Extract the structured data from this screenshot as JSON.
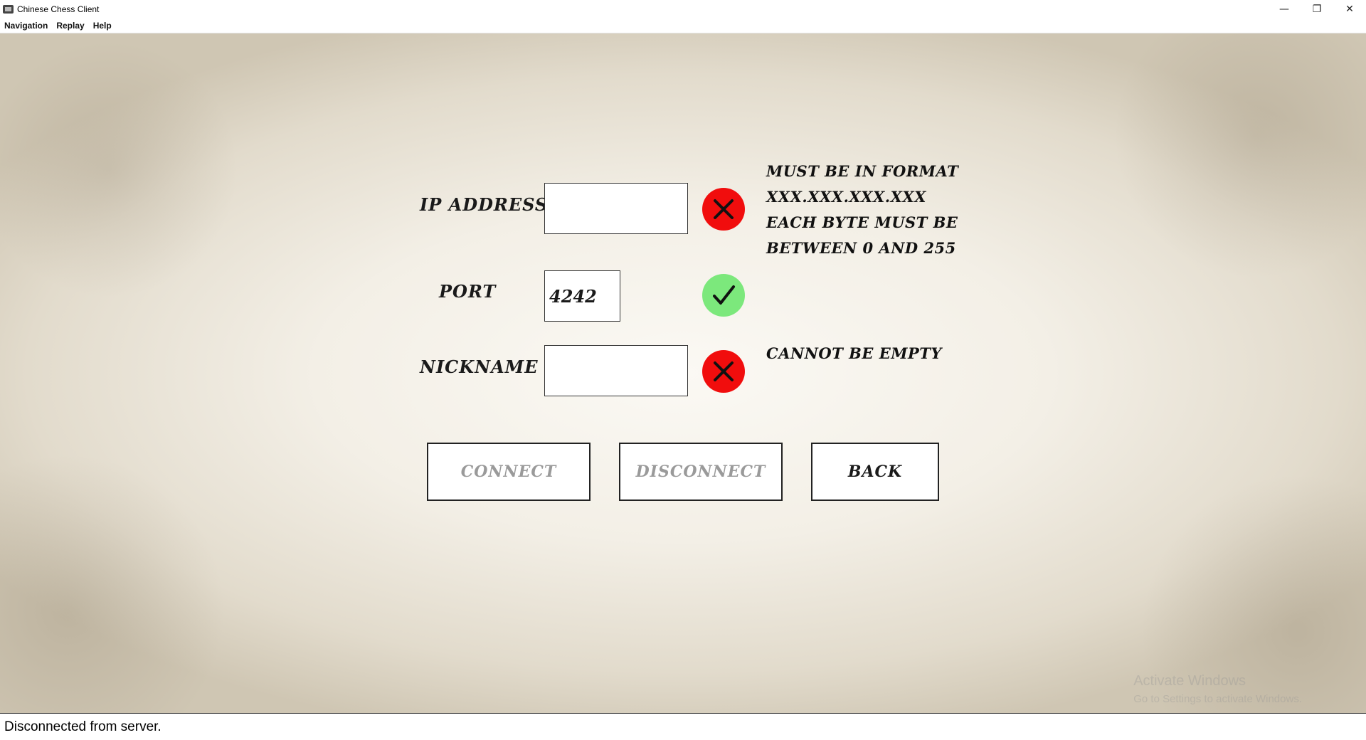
{
  "window": {
    "title": "Chinese Chess Client",
    "minimize_glyph": "—",
    "maximize_glyph": "❐",
    "close_glyph": "✕"
  },
  "menu": [
    "Navigation",
    "Replay",
    "Help"
  ],
  "form": {
    "ip": {
      "label": "IP ADDRESS",
      "value": "",
      "valid": false,
      "messages": [
        "MUST BE IN FORMAT",
        "XXX.XXX.XXX.XXX",
        "EACH BYTE MUST BE",
        "BETWEEN 0 AND 255"
      ]
    },
    "port": {
      "label": "PORT",
      "value": "4242",
      "valid": true
    },
    "nickname": {
      "label": "NICKNAME",
      "value": "",
      "valid": false,
      "messages": [
        "CANNOT BE EMPTY"
      ]
    }
  },
  "buttons": {
    "connect": "CONNECT",
    "disconnect": "DISCONNECT",
    "back": "BACK"
  },
  "watermark": {
    "title": "Activate Windows",
    "subtitle": "Go to Settings to activate Windows."
  },
  "status_bar": "Disconnected from server.",
  "colors": {
    "invalid": "#f10d0d",
    "valid": "#7ce87c"
  },
  "icons": {
    "invalid": "x-icon",
    "valid": "check-icon"
  }
}
